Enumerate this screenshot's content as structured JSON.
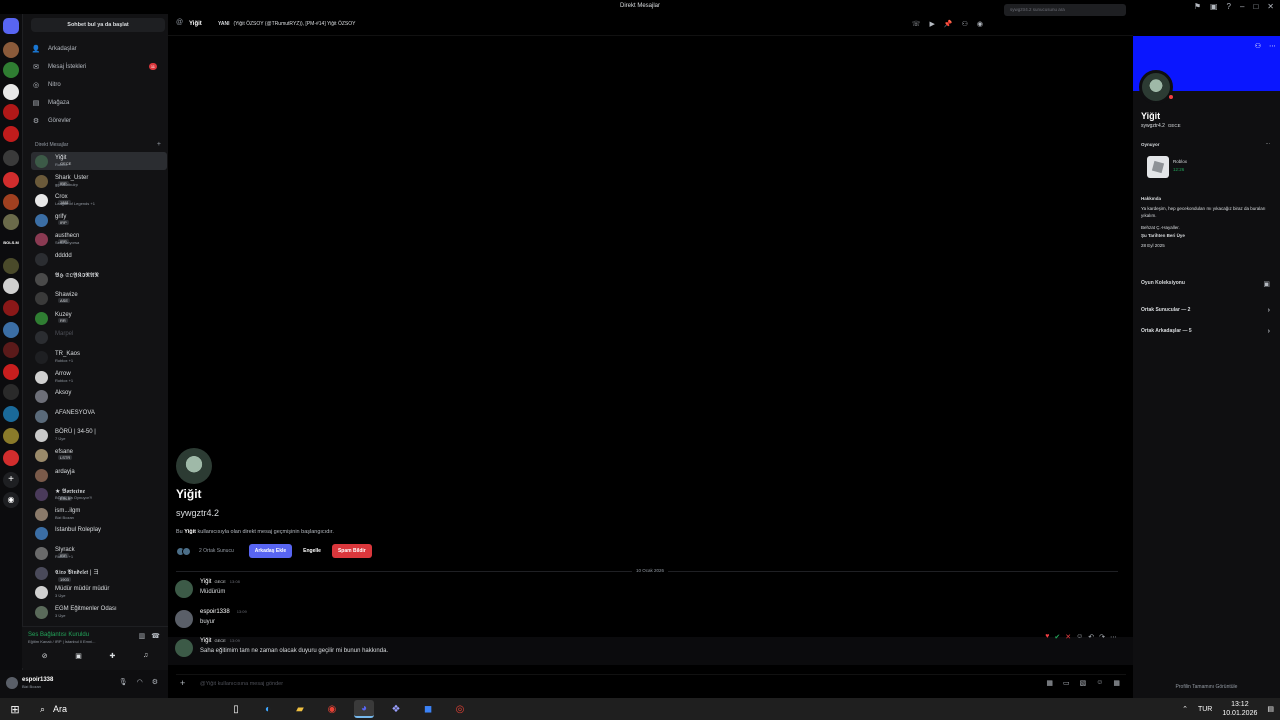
{
  "window": {
    "title": "Direkt Mesajlar"
  },
  "sidebar": {
    "search_label": "Sohbet bul ya da başlat",
    "nav": [
      {
        "label": "Arkadaşlar",
        "icon": "friends-icon"
      },
      {
        "label": "Mesaj İstekleri",
        "icon": "mail-icon",
        "badge": "11"
      },
      {
        "label": "Nitro",
        "icon": "nitro-icon"
      },
      {
        "label": "Mağaza",
        "icon": "shop-icon"
      },
      {
        "label": "Görevler",
        "icon": "quests-icon"
      }
    ],
    "dm_header": "Direkt Mesajlar",
    "dms": [
      {
        "name": "Yiğit",
        "tag": "GECE",
        "sub": "Roblox",
        "active": true,
        "color": "#3c5a47"
      },
      {
        "name": "Shark_Uster",
        "tag": "IRP",
        "sub": "gg.istanbulrp",
        "color": "#6b5a3a"
      },
      {
        "name": "Crox",
        "tag": "1881",
        "sub": "League of Legends +1",
        "color": "#e8e8e8"
      },
      {
        "name": "grify",
        "tag": "IRP",
        "sub": "",
        "color": "#3b6ea5"
      },
      {
        "name": "austhecn",
        "tag": "IRP",
        "sub": "Sesli arıyorsa",
        "color": "#8a3a52"
      },
      {
        "name": "ddddd",
        "tag": "",
        "sub": "",
        "color": "#2b2d31"
      },
      {
        "name": "𝕭𝕳 𝕾𝕺𝖄𝕶𝕴𝕽𝕬𝕹",
        "tag": "",
        "sub": "",
        "color": "#4a4a4a"
      },
      {
        "name": "Shawize",
        "tag": "ASE",
        "sub": "",
        "color": "#3a3a3a"
      },
      {
        "name": "Kuzey",
        "tag": "RR",
        "sub": "",
        "color": "#2f7d32"
      },
      {
        "name": "Marpel",
        "tag": "",
        "sub": "",
        "dim": true,
        "color": "#2b2d31"
      },
      {
        "name": "TR_Kaos",
        "tag": "",
        "sub": "Roblox +1",
        "color": "#1e1f22"
      },
      {
        "name": "Arrow",
        "tag": "",
        "sub": "Roblox +1",
        "color": "#d0d0d0"
      },
      {
        "name": "Aksoy",
        "tag": "",
        "sub": "",
        "color": "#6d6f78"
      },
      {
        "name": "AFANESYOVA",
        "tag": "",
        "sub": "",
        "color": "#5a6a7a"
      },
      {
        "name": "BÖRÜ | 34-50 |",
        "tag": "",
        "sub": "7 Üye",
        "color": "#c9c9c9"
      },
      {
        "name": "efsane",
        "tag": "LSTR",
        "sub": "",
        "color": "#9a8a6a"
      },
      {
        "name": "ardayja",
        "tag": "",
        "sub": "",
        "color": "#7a5a4a"
      },
      {
        "name": "★ 𝕭𝖔𝖗𝖙𝖊𝖈𝖎𝖓𝖊",
        "tag": "ERLK",
        "sub": "BÖRÜ Na Oynuyor?!",
        "color": "#4a3a5a"
      },
      {
        "name": "ism...ilgm",
        "tag": "",
        "sub": "Bizi Bozan",
        "color": "#8a7a6a"
      },
      {
        "name": "Istanbul Roleplay",
        "tag": "",
        "sub": "",
        "color": "#3b6ea5"
      },
      {
        "name": "Slyrack",
        "tag": "IRP",
        "sub": "Roblox +1",
        "color": "#6a6a6a"
      },
      {
        "name": "𝕮𝖎𝖗𝖔 𝖁𝖎𝖓𝖉𝖊𝖑𝖊𝖙 | ヨ",
        "tag": "1903",
        "sub": "",
        "color": "#4a4a5a"
      },
      {
        "name": "Müdür müdür müdür",
        "tag": "",
        "sub": "3 Üye",
        "color": "#d0d0d0"
      },
      {
        "name": "EGM Eğitmenler Odası",
        "tag": "",
        "sub": "3 Üye",
        "color": "#5a6a5a"
      }
    ]
  },
  "voice": {
    "status": "Ses Bağlantısı Kuruldu",
    "location": "Eğitim Kanalı / IRP | İstanbul Il Emni..."
  },
  "user": {
    "name": "espoir1338",
    "status": "Bizi Bozan"
  },
  "chat": {
    "header": {
      "name": "Yiğit",
      "desc_label": "YANI",
      "desc": "(Yiğit ÖZSOY (@TRumutRYZ)), [PM-#14] Yiğit ÖZSOY",
      "search_placeholder": "sywgztr4.2 sunucusunu ara"
    },
    "intro": {
      "name": "Yiğit",
      "handle": "sywgztr4.2",
      "text_before": "Bu ",
      "text_name": "Yiğit",
      "text_after": " kullanıcısıyla olan direkt mesaj geçmişinin başlangıcıdır.",
      "common_servers": "2 Ortak Sunucu",
      "add_friend": "Arkadaş Ekle",
      "block": "Engelle",
      "report_spam": "Spam Bildir"
    },
    "date_divider": "10 Ocak 2026",
    "messages": [
      {
        "author": "Yiğit",
        "tag": "GECE",
        "time": "13:08",
        "text": "Müdürüm",
        "color": "#3c5a47"
      },
      {
        "author": "espoir1338",
        "tag": "",
        "time": "13:09",
        "text": "buyur",
        "color": "#5a5f68"
      },
      {
        "author": "Yiğit",
        "tag": "GECE",
        "time": "13:09",
        "text": "Saha eğitimim tam ne zaman olacak duyuru geçilir mi bunun hakkında.",
        "color": "#3c5a47"
      }
    ],
    "composer_placeholder": "@Yiğit kullanıcısına mesaj gönder"
  },
  "profile": {
    "name": "Yiğit",
    "handle": "sywgztr4.2",
    "tag": "GECE",
    "banner_color": "#0a16ff",
    "playing_label": "Oynuyor",
    "game": "Roblox",
    "game_time": "12:26",
    "about_label": "Hakkında",
    "about_text": "Ya kardeşim, hep gecekonduları mı yıkacağız biraz da buraları yıkalım.",
    "about_quote": "Behzat Ç.-Hayaller.",
    "member_since_label": "Şu Tarihten Beri Üye",
    "member_since": "28 Eyl 2025",
    "game_collection": "Oyun Koleksiyonu",
    "common_servers": "Ortak Sunucular — 2",
    "common_friends": "Ortak Arkadaşlar — 5",
    "footer": "Profilin Tamamını Görüntüle"
  },
  "taskbar": {
    "search": "Ara",
    "lang": "TUR",
    "time": "13:12",
    "date": "10.01.2026"
  }
}
